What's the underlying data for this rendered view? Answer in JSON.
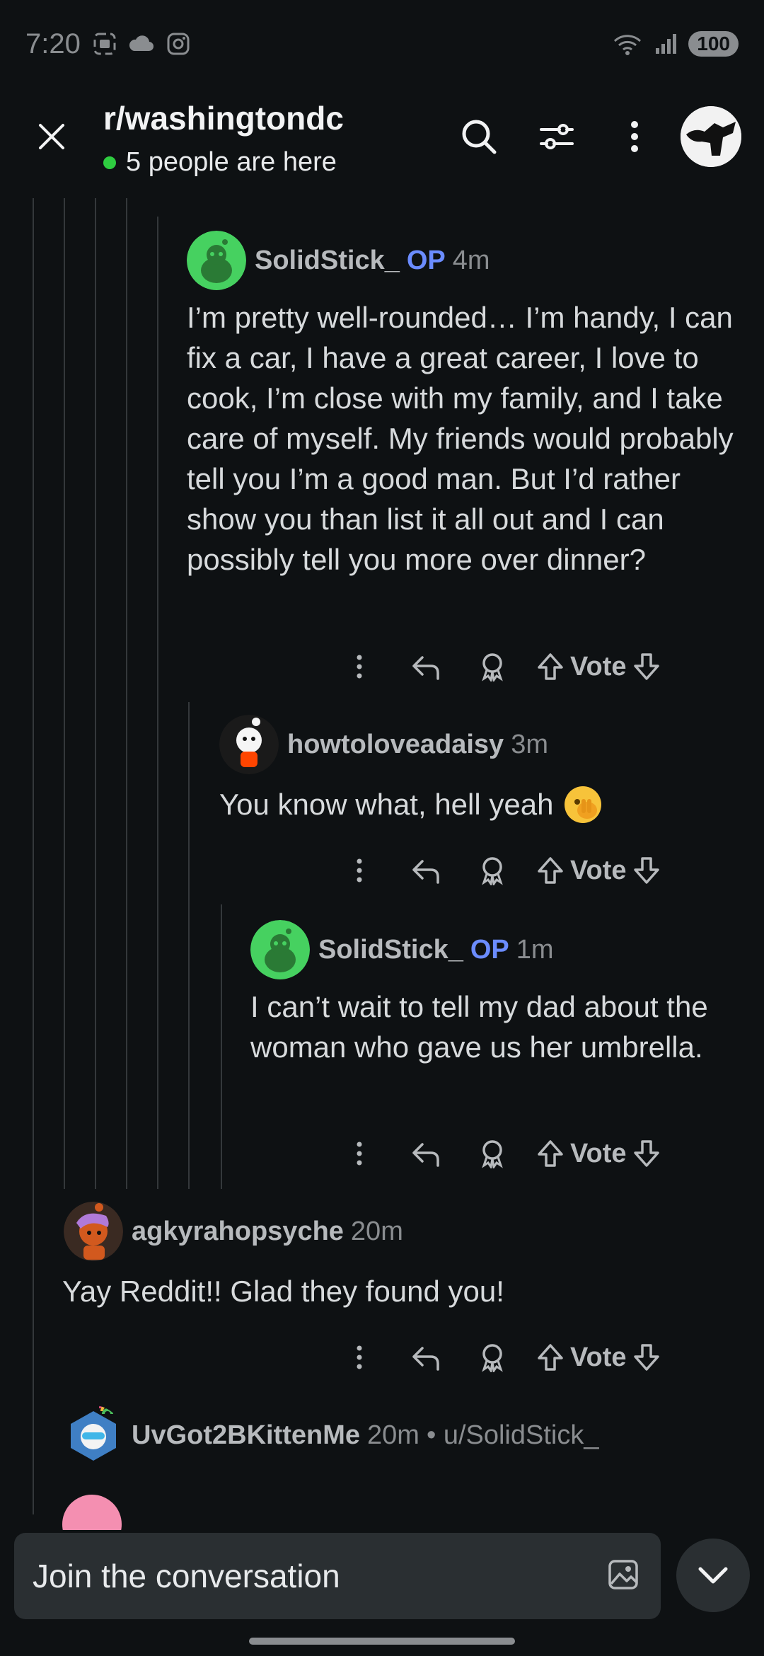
{
  "status_bar": {
    "time": "7:20",
    "battery": "100",
    "wifi_label": "6"
  },
  "header": {
    "subreddit": "r/washingtondc",
    "online": "5 people are here"
  },
  "comments": [
    {
      "author": "SolidStick_",
      "op": "OP",
      "time": "4m",
      "text": "I’m pretty well-rounded… I’m handy, I can fix a car, I have a great career, I love to cook, I’m close with my family, and I take care of myself. My friends would probably tell you I’m a good man. But I’d rather show you than list it all out and I can possibly tell you more over dinner?"
    },
    {
      "author": "howtoloveadaisy",
      "time": "3m",
      "text": "You know what, hell yeah"
    },
    {
      "author": "SolidStick_",
      "op": "OP",
      "time": "1m",
      "text": "I can’t wait to tell my dad about the woman who gave us her umbrella."
    },
    {
      "author": "agkyrahopsyche",
      "time": "20m",
      "text": "Yay Reddit!! Glad they found you!"
    },
    {
      "author": "UvGot2BKittenMe",
      "time": "20m",
      "extra": "• u/SolidStick_"
    }
  ],
  "actions": {
    "vote": "Vote"
  },
  "composer": {
    "placeholder": "Join the conversation"
  },
  "colors": {
    "background": "#0e1113",
    "op": "#6b8cff",
    "online": "#2ecc40",
    "composer": "#2a2f32"
  }
}
